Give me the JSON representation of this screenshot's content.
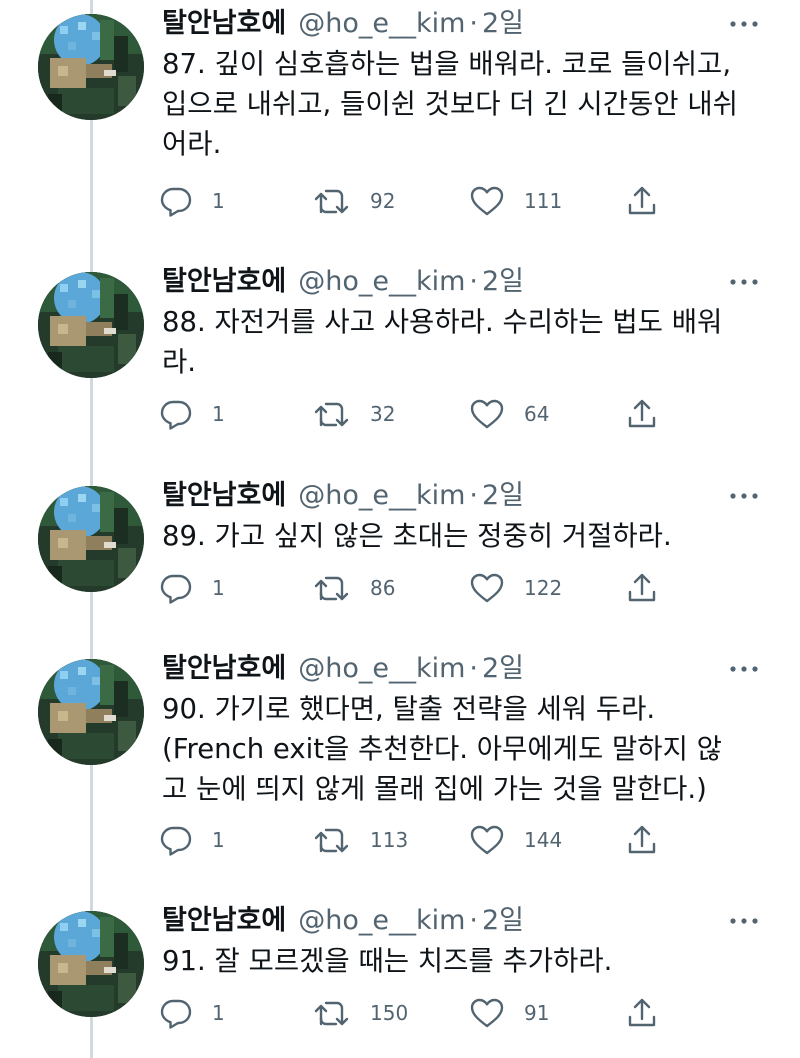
{
  "author": {
    "name": "탈안남호에",
    "handle": "@ho_e__kim",
    "separator": "·"
  },
  "icons": {
    "more": "more-horizontal-icon",
    "reply": "reply-icon",
    "retweet": "retweet-icon",
    "like": "heart-icon",
    "share": "share-icon"
  },
  "colors": {
    "text": "#0f1419",
    "secondary": "#536471",
    "thread_line": "#cfd9de"
  },
  "tweets": [
    {
      "time": "2일",
      "text": "87. 깊이 심호흡하는 법을 배워라. 코로 들이쉬고,\n입으로 내쉬고, 들이쉰 것보다 더 긴 시간동안 내쉬\n어라.",
      "replies": "1",
      "retweets": "92",
      "likes": "111"
    },
    {
      "time": "2일",
      "text": "88. 자전거를 사고 사용하라. 수리하는 법도 배워\n라.",
      "replies": "1",
      "retweets": "32",
      "likes": "64"
    },
    {
      "time": "2일",
      "text": "89. 가고 싶지 않은 초대는 정중히 거절하라.",
      "replies": "1",
      "retweets": "86",
      "likes": "122"
    },
    {
      "time": "2일",
      "text": "90. 가기로 했다면, 탈출 전략을 세워 두라.\n(French exit을 추천한다. 아무에게도 말하지 않\n고 눈에 띄지 않게 몰래 집에 가는 것을 말한다.)",
      "replies": "1",
      "retweets": "113",
      "likes": "144"
    },
    {
      "time": "2일",
      "text": "91. 잘 모르겠을 때는 치즈를 추가하라.",
      "replies": "1",
      "retweets": "150",
      "likes": "91"
    }
  ]
}
